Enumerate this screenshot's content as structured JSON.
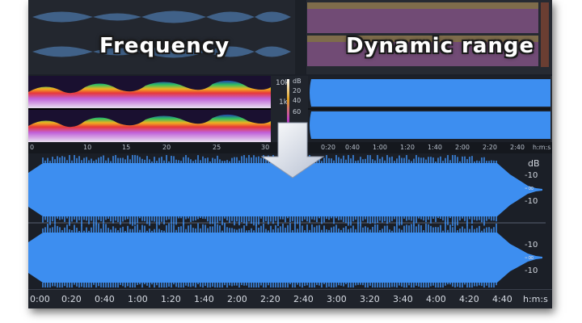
{
  "labels": {
    "frequency": "Frequency",
    "dynamic_range": "Dynamic range"
  },
  "spectrogram_scale": {
    "top": "10k",
    "mid": "1k",
    "db_unit": "dB",
    "db_values": [
      "20",
      "40",
      "60"
    ]
  },
  "spectro_ruler": [
    "0",
    "10",
    "15",
    "20",
    "25",
    "30"
  ],
  "small_wave_ruler": [
    "0:20",
    "0:40",
    "1:00",
    "1:20",
    "1:40",
    "2:00",
    "2:20",
    "2:40",
    "h:m:s"
  ],
  "small_wave_db": [
    "dB",
    "-10",
    "-∞",
    "-10",
    "-10",
    "-∞",
    "-10"
  ],
  "main": {
    "db_unit": "dB",
    "ch1_db": [
      "-10",
      "-∞",
      "-10"
    ],
    "ch2_db": [
      "-10",
      "-∞",
      "-10"
    ]
  },
  "timeline": [
    "0:00",
    "0:20",
    "0:40",
    "1:00",
    "1:20",
    "1:40",
    "2:00",
    "2:20",
    "2:40",
    "3:00",
    "3:20",
    "3:40",
    "4:00",
    "4:20",
    "4:40",
    "h:m:s"
  ],
  "colors": {
    "waveform": "#3d8ef0",
    "background": "#1b1f27",
    "arrow": "#dfe4ee"
  }
}
